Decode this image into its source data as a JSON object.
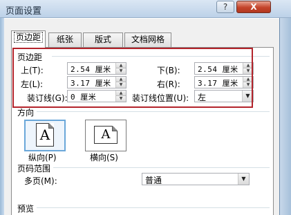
{
  "window": {
    "title": "页面设置",
    "help_label": "?",
    "close_label": "X"
  },
  "tabs": [
    {
      "label": "页边距",
      "active": true
    },
    {
      "label": "纸张",
      "active": false
    },
    {
      "label": "版式",
      "active": false
    },
    {
      "label": "文档网格",
      "active": false
    }
  ],
  "margins": {
    "section_title": "页边距",
    "top_label": "上(T):",
    "top_value": "2.54 厘米",
    "bottom_label": "下(B):",
    "bottom_value": "2.54 厘米",
    "left_label": "左(L):",
    "left_value": "3.17 厘米",
    "right_label": "右(R):",
    "right_value": "3.17 厘米",
    "gutter_label": "装订线(G):",
    "gutter_value": "0 厘米",
    "gutter_pos_label": "装订线位置(U):",
    "gutter_pos_value": "左"
  },
  "orientation": {
    "section_title": "方向",
    "portrait_label": "纵向(P)",
    "portrait_glyph": "A",
    "landscape_label": "横向(S)",
    "landscape_glyph": "A"
  },
  "pages": {
    "section_title": "页码范围",
    "multiple_label": "多页(M):",
    "multiple_value": "普通"
  },
  "preview": {
    "section_title": "预览"
  },
  "spin_glyphs": {
    "up": "▲",
    "down": "▼"
  },
  "select_glyph": "▼",
  "colors": {
    "highlight": "#b3232a",
    "close_button": "#c4442b",
    "selected_orientation": "#6aa7d9"
  }
}
